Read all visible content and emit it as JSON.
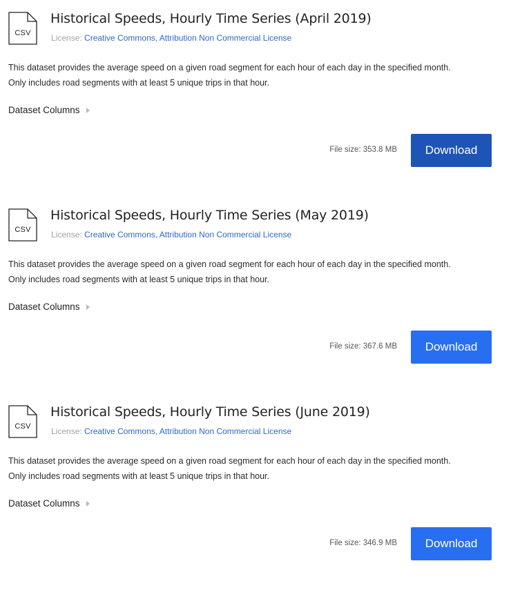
{
  "datasets": [
    {
      "icon_label": "CSV",
      "title": "Historical Speeds, Hourly Time Series (April 2019)",
      "license_label": "License:",
      "license_link": "Creative Commons, Attribution Non Commercial License",
      "description_line1": "This dataset provides the average speed on a given road segment for each hour of each day in the specified month.",
      "description_line2": "Only includes road segments with at least 5 unique trips in that hour.",
      "columns_label": "Dataset Columns",
      "file_size": "File size: 353.8 MB",
      "download_label": "Download"
    },
    {
      "icon_label": "CSV",
      "title": "Historical Speeds, Hourly Time Series (May 2019)",
      "license_label": "License:",
      "license_link": "Creative Commons, Attribution Non Commercial License",
      "description_line1": "This dataset provides the average speed on a given road segment for each hour of each day in the specified month.",
      "description_line2": "Only includes road segments with at least 5 unique trips in that hour.",
      "columns_label": "Dataset Columns",
      "file_size": "File size: 367.6 MB",
      "download_label": "Download"
    },
    {
      "icon_label": "CSV",
      "title": "Historical Speeds, Hourly Time Series (June 2019)",
      "license_label": "License:",
      "license_link": "Creative Commons, Attribution Non Commercial License",
      "description_line1": "This dataset provides the average speed on a given road segment for each hour of each day in the specified month.",
      "description_line2": "Only includes road segments with at least 5 unique trips in that hour.",
      "columns_label": "Dataset Columns",
      "file_size": "File size: 346.9 MB",
      "download_label": "Download"
    }
  ],
  "colors": {
    "download_button": "#276ef1",
    "download_button_active": "#1e54b7",
    "license_link": "#2f67c7"
  }
}
